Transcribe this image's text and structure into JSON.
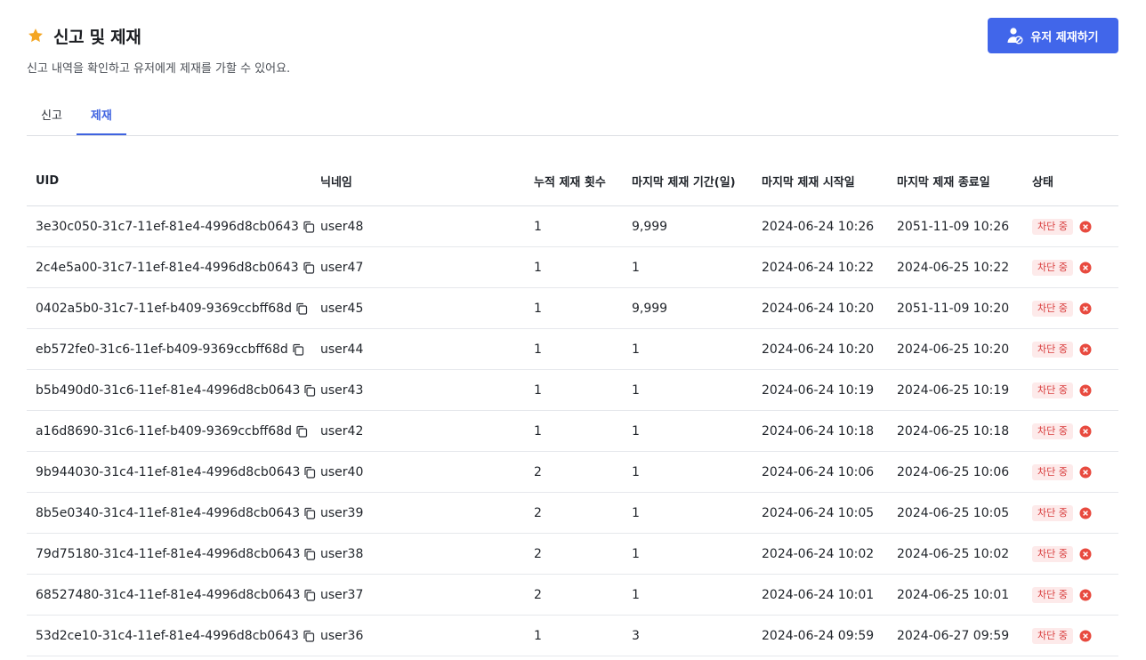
{
  "page": {
    "title": "신고 및 제재",
    "subtitle": "신고 내역을 확인하고 유저에게 제재를 가할 수 있어요.",
    "title_icon": "star-icon",
    "accent_color": "#4166ea",
    "star_color": "#f4a623"
  },
  "actions": {
    "sanction_user_label": "유저 제재하기",
    "icon": "user-block-icon"
  },
  "tabs": [
    {
      "label": "신고",
      "active": false
    },
    {
      "label": "제재",
      "active": true
    }
  ],
  "table": {
    "columns": [
      "UID",
      "닉네임",
      "누적 제재 횟수",
      "마지막 제재 기간(일)",
      "마지막 제재 시작일",
      "마지막 제재 종료일",
      "상태"
    ],
    "rows": [
      {
        "uid": "3e30c050-31c7-11ef-81e4-4996d8cb0643",
        "nickname": "user48",
        "count": "1",
        "period": "9,999",
        "start": "2024-06-24 10:26",
        "end": "2051-11-09 10:26",
        "status": "차단 중"
      },
      {
        "uid": "2c4e5a00-31c7-11ef-81e4-4996d8cb0643",
        "nickname": "user47",
        "count": "1",
        "period": "1",
        "start": "2024-06-24 10:22",
        "end": "2024-06-25 10:22",
        "status": "차단 중"
      },
      {
        "uid": "0402a5b0-31c7-11ef-b409-9369ccbff68d",
        "nickname": "user45",
        "count": "1",
        "period": "9,999",
        "start": "2024-06-24 10:20",
        "end": "2051-11-09 10:20",
        "status": "차단 중"
      },
      {
        "uid": "eb572fe0-31c6-11ef-b409-9369ccbff68d",
        "nickname": "user44",
        "count": "1",
        "period": "1",
        "start": "2024-06-24 10:20",
        "end": "2024-06-25 10:20",
        "status": "차단 중"
      },
      {
        "uid": "b5b490d0-31c6-11ef-81e4-4996d8cb0643",
        "nickname": "user43",
        "count": "1",
        "period": "1",
        "start": "2024-06-24 10:19",
        "end": "2024-06-25 10:19",
        "status": "차단 중"
      },
      {
        "uid": "a16d8690-31c6-11ef-b409-9369ccbff68d",
        "nickname": "user42",
        "count": "1",
        "period": "1",
        "start": "2024-06-24 10:18",
        "end": "2024-06-25 10:18",
        "status": "차단 중"
      },
      {
        "uid": "9b944030-31c4-11ef-81e4-4996d8cb0643",
        "nickname": "user40",
        "count": "2",
        "period": "1",
        "start": "2024-06-24 10:06",
        "end": "2024-06-25 10:06",
        "status": "차단 중"
      },
      {
        "uid": "8b5e0340-31c4-11ef-81e4-4996d8cb0643",
        "nickname": "user39",
        "count": "2",
        "period": "1",
        "start": "2024-06-24 10:05",
        "end": "2024-06-25 10:05",
        "status": "차단 중"
      },
      {
        "uid": "79d75180-31c4-11ef-81e4-4996d8cb0643",
        "nickname": "user38",
        "count": "2",
        "period": "1",
        "start": "2024-06-24 10:02",
        "end": "2024-06-25 10:02",
        "status": "차단 중"
      },
      {
        "uid": "68527480-31c4-11ef-81e4-4996d8cb0643",
        "nickname": "user37",
        "count": "2",
        "period": "1",
        "start": "2024-06-24 10:01",
        "end": "2024-06-25 10:01",
        "status": "차단 중"
      },
      {
        "uid": "53d2ce10-31c4-11ef-81e4-4996d8cb0643",
        "nickname": "user36",
        "count": "1",
        "period": "3",
        "start": "2024-06-24 09:59",
        "end": "2024-06-27 09:59",
        "status": "차단 중"
      }
    ]
  }
}
